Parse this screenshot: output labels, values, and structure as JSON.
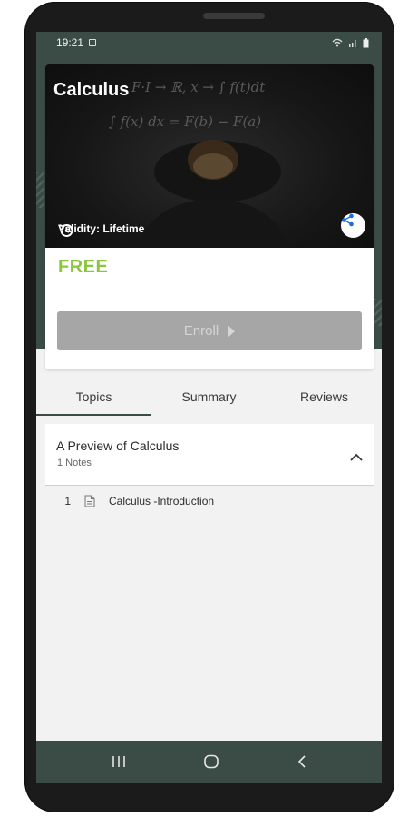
{
  "status_bar": {
    "time": "19:21"
  },
  "course": {
    "title": "Calculus",
    "validity": "Validity: Lifetime",
    "price": "FREE",
    "enroll_label": "Enroll"
  },
  "tabs": [
    {
      "label": "Topics",
      "active": true
    },
    {
      "label": "Summary",
      "active": false
    },
    {
      "label": "Reviews",
      "active": false
    }
  ],
  "section": {
    "title": "A Preview of Calculus",
    "subtitle": "1 Notes",
    "topics": [
      {
        "number": "1",
        "label": "Calculus -Introduction",
        "icon": "document-icon"
      }
    ]
  },
  "hero_formulas": {
    "line1": "F·I → ℝ,  x → ∫ f(t)dt",
    "line2": "∫ f(x) dx  =  F(b) − F(a)"
  },
  "colors": {
    "header": "#3b4b45",
    "price": "#8cc63f",
    "enroll_disabled": "#a6a6a6"
  }
}
